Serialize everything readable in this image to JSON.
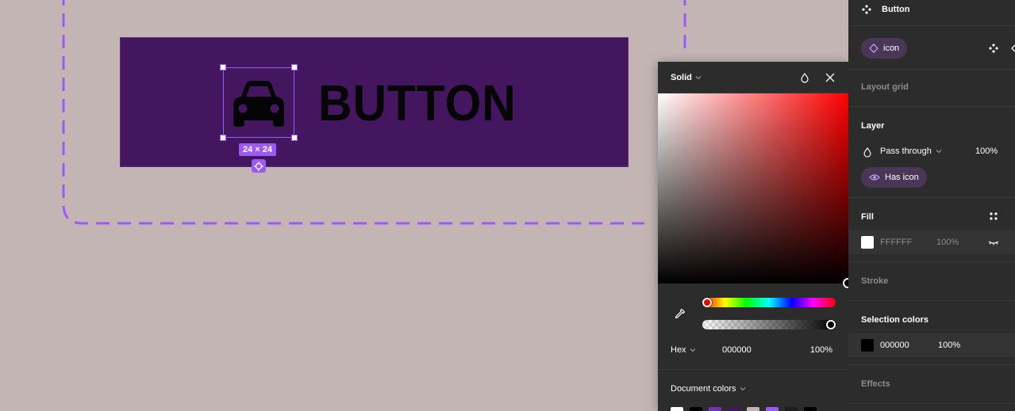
{
  "canvas": {
    "button_label": "BUTTON",
    "size_badge": "24 × 24",
    "frame_color": "#9b59f5",
    "button_bg": "#441660"
  },
  "color_picker": {
    "fill_type": "Solid",
    "hex_mode_label": "Hex",
    "hex_value": "000000",
    "opacity": "100%",
    "document_colors_label": "Document colors",
    "swatches": [
      "#ffffff",
      "#000000",
      "#7b2fb8",
      "#441660",
      "#c4b5b5",
      "#9b59f5",
      "#1e1e1e",
      "#000000"
    ]
  },
  "panel": {
    "component_name": "Button",
    "instance_property": "icon",
    "layout_grid_label": "Layout grid",
    "layer": {
      "title": "Layer",
      "blend_mode": "Pass through",
      "opacity": "100%",
      "property_pill": "Has icon"
    },
    "fill": {
      "title": "Fill",
      "hex": "FFFFFF",
      "opacity": "100%"
    },
    "stroke_label": "Stroke",
    "selection_colors": {
      "title": "Selection colors",
      "hex": "000000",
      "opacity": "100%"
    },
    "effects_label": "Effects"
  }
}
